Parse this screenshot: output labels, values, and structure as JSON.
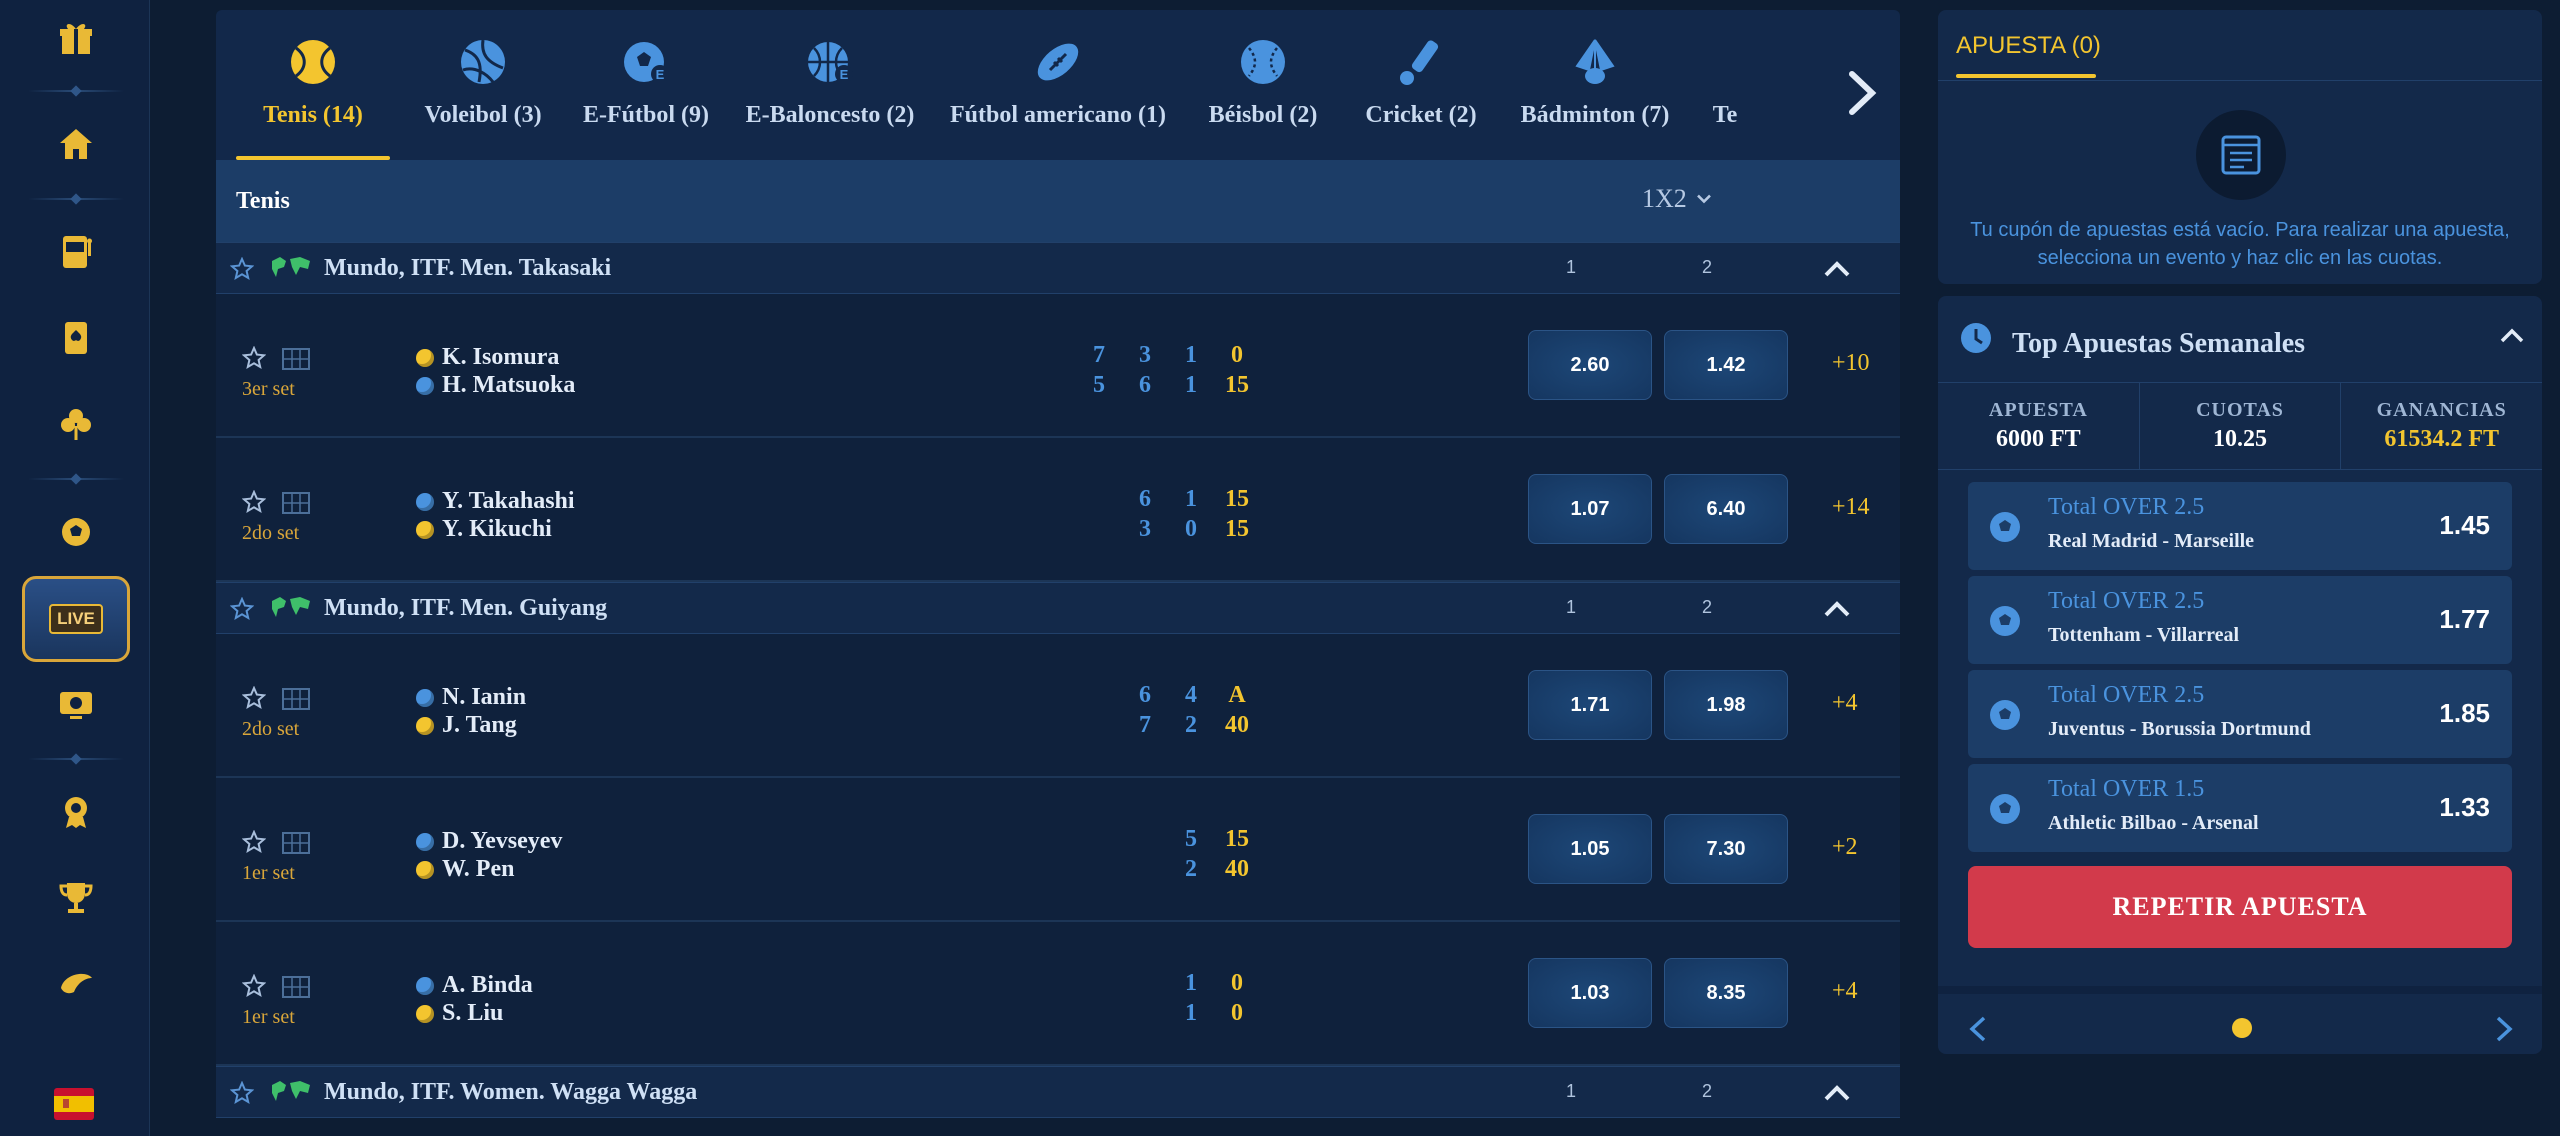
{
  "sports": [
    {
      "label": "Tenis (14)",
      "icon": "tennis-ball-icon",
      "active": true
    },
    {
      "label": "Voleibol (3)",
      "icon": "volleyball-icon"
    },
    {
      "label": "E-Fútbol (9)",
      "icon": "esoccer-icon"
    },
    {
      "label": "E-Baloncesto (2)",
      "icon": "ebasketball-icon"
    },
    {
      "label": "Fútbol americano (1)",
      "icon": "american-football-icon"
    },
    {
      "label": "Béisbol (2)",
      "icon": "baseball-icon"
    },
    {
      "label": "Cricket (2)",
      "icon": "cricket-icon"
    },
    {
      "label": "Bádminton (7)",
      "icon": "shuttlecock-icon"
    },
    {
      "label": "Te",
      "icon": "tennis-icon"
    }
  ],
  "section": {
    "title": "Tenis",
    "market": "1X2"
  },
  "leagues": [
    {
      "name": "Mundo, ITF. Men. Takasaki",
      "col1": "1",
      "col2": "2",
      "matches": [
        {
          "set": "3er set",
          "p1": "K. Isomura",
          "p2": "H. Matsuoka",
          "serve": [
            "y",
            "b"
          ],
          "games": [
            [
              "7",
              "5"
            ],
            [
              "3",
              "6"
            ],
            [
              "1",
              "1"
            ]
          ],
          "points": [
            "0",
            "15"
          ],
          "odd1": "2.60",
          "odd2": "1.42",
          "more": "+10"
        },
        {
          "set": "2do set",
          "p1": "Y. Takahashi",
          "p2": "Y. Kikuchi",
          "serve": [
            "b",
            "y"
          ],
          "games": [
            [
              "6",
              "3"
            ],
            [
              "1",
              "0"
            ]
          ],
          "points": [
            "15",
            "15"
          ],
          "odd1": "1.07",
          "odd2": "6.40",
          "more": "+14"
        }
      ]
    },
    {
      "name": "Mundo, ITF. Men. Guiyang",
      "col1": "1",
      "col2": "2",
      "matches": [
        {
          "set": "2do set",
          "p1": "N. Ianin",
          "p2": "J. Tang",
          "serve": [
            "b",
            "y"
          ],
          "games": [
            [
              "6",
              "7"
            ],
            [
              "4",
              "2"
            ]
          ],
          "points": [
            "A",
            "40"
          ],
          "odd1": "1.71",
          "odd2": "1.98",
          "more": "+4"
        },
        {
          "set": "1er set",
          "p1": "D. Yevseyev",
          "p2": "W. Pen",
          "serve": [
            "b",
            "y"
          ],
          "games": [
            [
              "5",
              "2"
            ]
          ],
          "points": [
            "15",
            "40"
          ],
          "odd1": "1.05",
          "odd2": "7.30",
          "more": "+2"
        },
        {
          "set": "1er set",
          "p1": "A. Binda",
          "p2": "S. Liu",
          "serve": [
            "b",
            "y"
          ],
          "games": [
            [
              "1",
              "1"
            ]
          ],
          "points": [
            "0",
            "0"
          ],
          "odd1": "1.03",
          "odd2": "8.35",
          "more": "+4"
        }
      ]
    },
    {
      "name": "Mundo, ITF. Women. Wagga Wagga",
      "col1": "1",
      "col2": "2",
      "matches": []
    }
  ],
  "slip": {
    "tab": "APUESTA (0)",
    "message": "Tu cupón de apuestas está vacío. Para realizar una apuesta, selecciona un evento y haz clic en las cuotas."
  },
  "top": {
    "title": "Top Apuestas Semanales",
    "stats": [
      {
        "k": "APUESTA",
        "v": "6000 FT"
      },
      {
        "k": "CUOTAS",
        "v": "10.25"
      },
      {
        "k": "GANANCIAS",
        "v": "61534.2 FT",
        "gold": true
      }
    ],
    "bets": [
      {
        "market": "Total OVER 2.5",
        "teams": "Real Madrid - Marseille",
        "odd": "1.45"
      },
      {
        "market": "Total OVER 2.5",
        "teams": "Tottenham - Villarreal",
        "odd": "1.77"
      },
      {
        "market": "Total OVER 2.5",
        "teams": "Juventus - Borussia Dortmund",
        "odd": "1.85"
      },
      {
        "market": "Total OVER 1.5",
        "teams": "Athletic Bilbao - Arsenal",
        "odd": "1.33"
      }
    ],
    "repeat": "REPETIR APUESTA"
  },
  "sidebar": {
    "live": "LIVE",
    "icons": [
      "gift-icon",
      "home-icon",
      "slot-machine-icon",
      "card-icon",
      "clover-icon",
      "soccer-ball-icon",
      "live-icon",
      "virtual-sports-icon",
      "badge-icon",
      "trophy-icon",
      "croissant-icon",
      "spain-flag-icon"
    ]
  },
  "colors": {
    "accent": "#f3c52f",
    "blue": "#4a93de",
    "cta": "#d23a4b",
    "bg": "#0d1d33"
  }
}
